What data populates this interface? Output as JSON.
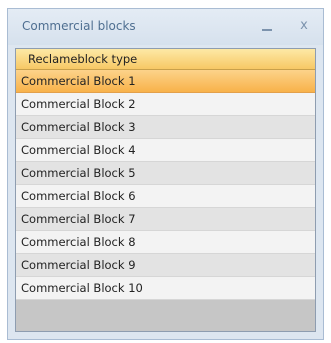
{
  "window": {
    "title": "Commercial blocks",
    "minimize_symbol": "_",
    "close_symbol": "x"
  },
  "grid": {
    "column_header": "Reclameblock type",
    "rows": [
      "Commercial Block 1",
      "Commercial Block 2",
      "Commercial Block 3",
      "Commercial Block 4",
      "Commercial Block 5",
      "Commercial Block 6",
      "Commercial Block 7",
      "Commercial Block 8",
      "Commercial Block 9",
      "Commercial Block 10"
    ],
    "selected_row": "Commercial Block 1"
  },
  "colors": {
    "selection": "#f8b24a",
    "header": "#f7c865",
    "title_text": "#4f6f91"
  }
}
